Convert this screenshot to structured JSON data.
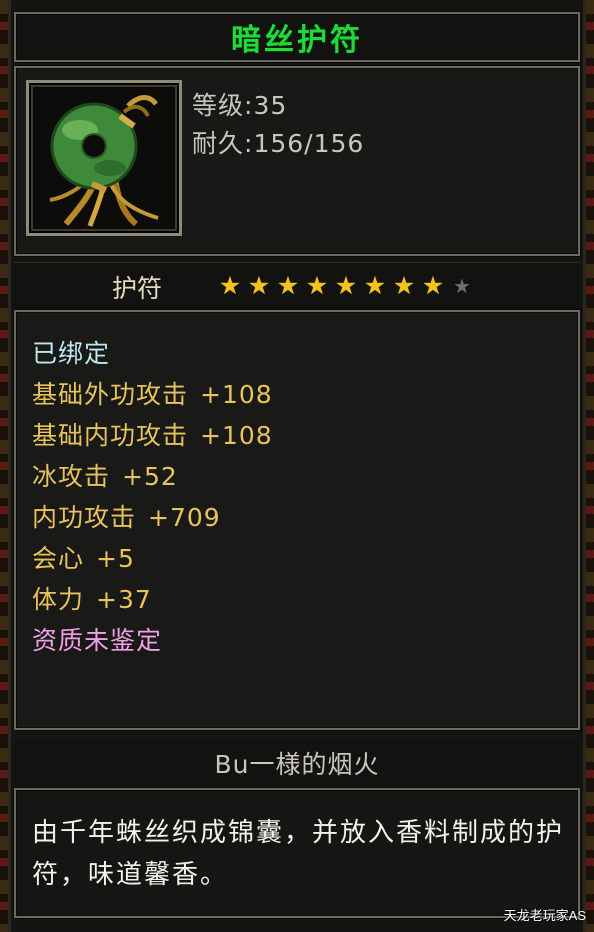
{
  "item": {
    "name": "暗丝护符",
    "level_label": "等级",
    "level_value": ":35",
    "durability_label": "耐久",
    "durability_value": ":156/156",
    "type": "护符",
    "stars_filled": 8,
    "stars_total": 9
  },
  "attributes": [
    {
      "label": "已绑定",
      "value": "",
      "color": "#bfe7ee"
    },
    {
      "label": "基础外功攻击",
      "value": "+108",
      "color": "#e8c35a"
    },
    {
      "label": "基础内功攻击",
      "value": "+108",
      "color": "#e8c35a"
    },
    {
      "label": "冰攻击",
      "value": "+52",
      "color": "#e8c35a"
    },
    {
      "label": "内功攻击",
      "value": "+709",
      "color": "#e8c35a"
    },
    {
      "label": "会心",
      "value": "+5",
      "color": "#e8c35a"
    },
    {
      "label": "体力",
      "value": "+37",
      "color": "#e8c35a"
    },
    {
      "label": "资质未鉴定",
      "value": "",
      "color": "#f0a0e4"
    }
  ],
  "owner": "Bu一様的烟火",
  "description": "由千年蛛丝织成锦囊，并放入香料制成的护符，味道馨香。",
  "watermark": "天龙老玩家AS",
  "colors": {
    "title": "#21d93a",
    "star_on": "#f2c31c",
    "star_off": "#6e6e6a"
  }
}
